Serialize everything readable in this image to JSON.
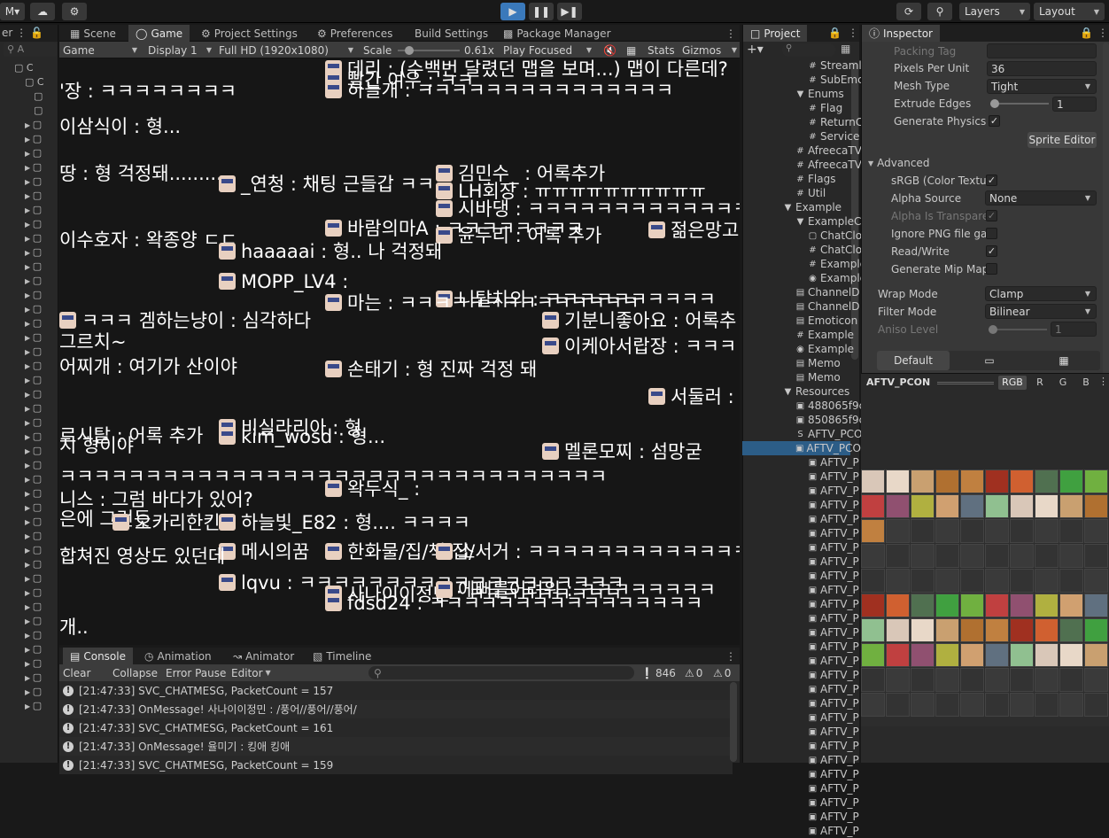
{
  "topbar": {
    "account_label": "M",
    "layers_label": "Layers",
    "layout_label": "Layout"
  },
  "game_tabs": [
    {
      "label": "Scene"
    },
    {
      "label": "Game"
    },
    {
      "label": "Project Settings"
    },
    {
      "label": "Preferences"
    },
    {
      "label": "Build Settings"
    },
    {
      "label": "Package Manager"
    }
  ],
  "game_toolbar": {
    "mode": "Game",
    "display": "Display 1",
    "resolution": "Full HD (1920x1080)",
    "scale_label": "Scale",
    "scale_value": "0.61x",
    "play_focused": "Play Focused",
    "stats": "Stats",
    "gizmos": "Gizmos"
  },
  "hierarchy": {
    "search_placeholder": "A",
    "root_items": [
      "C",
      "C"
    ]
  },
  "chat_lines": [
    {
      "text": "데리 : (수백번 달렸던 맵을 보며...) 맵이 다른데?",
      "avatar": true
    },
    {
      "text": "빨간 여우 : ㅋㅋ",
      "avatar": true
    },
    {
      "text": "하늘개 : ㅋㅋㅋㅋㅋㅋㅋㅋㅋㅋㅋㅋㅋㅋㅋ",
      "avatar": true
    },
    {
      "text": "'장 : ㅋㅋㅋㅋㅋㅋㅋㅋ",
      "avatar": false
    },
    {
      "text": "이삼식이 : 형...",
      "avatar": false
    },
    {
      "text": "땅 : 형 걱정돼.........",
      "avatar": false
    },
    {
      "text": "_연청 : 채팅 근들갑 ㅋㅋ",
      "avatar": true
    },
    {
      "text": "김민수_ : 어록추가",
      "avatar": true
    },
    {
      "text": "LH회장 : ㅠㅠㅠㅠㅠㅠㅠㅠㅠㅠ",
      "avatar": true
    },
    {
      "text": "시바댕 : ㅋㅋㅋㅋㅋㅋㅋㅋㅋㅋㅋㅋㅋㅋ",
      "avatar": true
    },
    {
      "text": "바람의마A : ㅋㅋㅋㅋㅋㅋㅋㅋ",
      "avatar": true
    },
    {
      "text": "윤두리 : 어록 추가",
      "avatar": true
    },
    {
      "text": "젊은망고",
      "avatar": true
    },
    {
      "text": "이수호자 : 왁종양 ㄷㄷ",
      "avatar": false
    },
    {
      "text": "haaaaai : 형.. 나 걱정돼",
      "avatar": true
    },
    {
      "text": "MOPP_LV4 :",
      "avatar": true
    },
    {
      "text": "니탈차의 : ㅋㅋㅋㅋㅋㅋㅋㅋㅋㅋ",
      "avatar": true
    },
    {
      "text": "마는 : ㅋㅋㅋㅋㅋㅋㅋㅋㅋㅋㅋㅋㅋㅋ",
      "avatar": true
    },
    {
      "text": "ㅋㅋㅋ 겜하는냥이 : 심각하다",
      "avatar": true
    },
    {
      "text": "기분니좋아요 : 어록추",
      "avatar": true
    },
    {
      "text": "그르치~",
      "avatar": false
    },
    {
      "text": "이케아서랍장 : ㅋㅋㅋ",
      "avatar": true
    },
    {
      "text": "어찌개 : 여기가 산이야",
      "avatar": false
    },
    {
      "text": "손태기 : 형 진짜 걱정 돼",
      "avatar": true
    },
    {
      "text": "서둘러 :",
      "avatar": true
    },
    {
      "text": "비실라리아 : 형",
      "avatar": true
    },
    {
      "text": "르시탈 : 어록 추가",
      "avatar": false
    },
    {
      "text": "kim_wosd : 형...",
      "avatar": true
    },
    {
      "text": "지 형이야",
      "avatar": false
    },
    {
      "text": "멜론모찌 : 섬망굳",
      "avatar": true
    },
    {
      "text": "ㅋㅋㅋㅋㅋㅋㅋㅋㅋㅋㅋㅋㅋㅋㅋㅋㅋㅋㅋㅋㅋㅋㅋㅋㅋㅋㅋㅋㅋㅋㅋㅋ",
      "avatar": false
    },
    {
      "text": "왁두식_ :",
      "avatar": true
    },
    {
      "text": "니스 : 그럼 바다가 있어?",
      "avatar": false
    },
    {
      "text": "은에 그런듯",
      "avatar": false
    },
    {
      "text": "오카리한킨",
      "avatar": true
    },
    {
      "text": "하늘빛_E82 : 형.... ㅋㅋㅋㅋ",
      "avatar": true
    },
    {
      "text": "메시의꿈",
      "avatar": true
    },
    {
      "text": "한화물/집/책/집/",
      "avatar": true
    },
    {
      "text": "소서거 : ㅋㅋㅋㅋㅋㅋㅋㅋㅋㅋㅋㅋㅋㅋ",
      "avatar": true
    },
    {
      "text": "합쳐진 영상도 있던데",
      "avatar": false
    },
    {
      "text": "lqvu : ㅋㅋㅋㅋㅋㅋㅋㅋㅋㅋㅋㅋㅋㅋㅋㅋㅋㅋㅋ",
      "avatar": true
    },
    {
      "text": "사나이이정민 : ㅋㅋㅋㅋㅋㅋㅋㅋㅋ",
      "avatar": true
    },
    {
      "text": "fdsd24 : ㅋㅋㅋㅋㅋㅋㅋㅋㅋㅋㅋㅋㅋㅋㅋㅋ",
      "avatar": true
    },
    {
      "text": "에뻐를어려워 : ㅋㅋㅋㅋㅋㅋㅋㅋ",
      "avatar": true
    },
    {
      "text": "개..",
      "avatar": false
    }
  ],
  "console": {
    "tabs": [
      "Console",
      "Animation",
      "Animator",
      "Timeline"
    ],
    "clear": "Clear",
    "collapse": "Collapse",
    "error_pause": "Error Pause",
    "editor": "Editor",
    "count_info": "846",
    "count_warn": "0",
    "count_error": "0",
    "logs": [
      "[21:47:33] SVC_CHATMESG, PacketCount = 157",
      "[21:47:33] OnMessage! 사나이이정민 : /풍어//풍어//풍어/",
      "[21:47:33] SVC_CHATMESG, PacketCount = 161",
      "[21:47:33] OnMessage! 율미기 : 킹애 킹애",
      "[21:47:33] SVC_CHATMESG, PacketCount = 159"
    ]
  },
  "project": {
    "tab": "Project",
    "items": [
      {
        "label": "Streaml",
        "icon": "#",
        "indent": 3
      },
      {
        "label": "SubEmc",
        "icon": "#",
        "indent": 3
      },
      {
        "label": "Enums",
        "icon": "folder",
        "indent": 2
      },
      {
        "label": "Flag",
        "icon": "#",
        "indent": 3
      },
      {
        "label": "ReturnC",
        "icon": "#",
        "indent": 3
      },
      {
        "label": "Service",
        "icon": "#",
        "indent": 3
      },
      {
        "label": "AfreecaTV",
        "icon": "#",
        "indent": 2
      },
      {
        "label": "AfreecaTV",
        "icon": "#",
        "indent": 2
      },
      {
        "label": "Flags",
        "icon": "#",
        "indent": 2
      },
      {
        "label": "Util",
        "icon": "#",
        "indent": 2
      },
      {
        "label": "Example",
        "icon": "folder",
        "indent": 1
      },
      {
        "label": "ExampleC",
        "icon": "folder",
        "indent": 2
      },
      {
        "label": "ChatClo",
        "icon": "cube",
        "indent": 3
      },
      {
        "label": "ChatClo",
        "icon": "#",
        "indent": 3
      },
      {
        "label": "Example",
        "icon": "#",
        "indent": 3
      },
      {
        "label": "Example",
        "icon": "unity",
        "indent": 3
      },
      {
        "label": "ChannelD",
        "icon": "doc",
        "indent": 2
      },
      {
        "label": "ChannelD",
        "icon": "doc",
        "indent": 2
      },
      {
        "label": "Emoticon",
        "icon": "doc",
        "indent": 2
      },
      {
        "label": "Example",
        "icon": "#",
        "indent": 2
      },
      {
        "label": "Example",
        "icon": "unity",
        "indent": 2
      },
      {
        "label": "Memo",
        "icon": "doc",
        "indent": 2
      },
      {
        "label": "Memo",
        "icon": "doc",
        "indent": 2
      },
      {
        "label": "Resources",
        "icon": "folder",
        "indent": 1
      },
      {
        "label": "488065f9c",
        "icon": "img",
        "indent": 2
      },
      {
        "label": "850865f9c",
        "icon": "img",
        "indent": 2
      },
      {
        "label": "AFTV_PCO",
        "icon": "S",
        "indent": 2
      },
      {
        "label": "AFTV_PCO",
        "icon": "img",
        "indent": 2
      },
      {
        "label": "AFTV_P",
        "icon": "img",
        "indent": 3
      },
      {
        "label": "AFTV_P",
        "icon": "img",
        "indent": 3
      },
      {
        "label": "AFTV_P",
        "icon": "img",
        "indent": 3
      },
      {
        "label": "AFTV_P",
        "icon": "img",
        "indent": 3
      },
      {
        "label": "AFTV_P",
        "icon": "img",
        "indent": 3
      },
      {
        "label": "AFTV_P",
        "icon": "img",
        "indent": 3
      },
      {
        "label": "AFTV_P",
        "icon": "img",
        "indent": 3
      },
      {
        "label": "AFTV_P",
        "icon": "img",
        "indent": 3
      },
      {
        "label": "AFTV_P",
        "icon": "img",
        "indent": 3
      },
      {
        "label": "AFTV_P",
        "icon": "img",
        "indent": 3
      },
      {
        "label": "AFTV_P",
        "icon": "img",
        "indent": 3
      },
      {
        "label": "AFTV_P",
        "icon": "img",
        "indent": 3
      },
      {
        "label": "AFTV_P",
        "icon": "img",
        "indent": 3
      },
      {
        "label": "AFTV_P",
        "icon": "img",
        "indent": 3
      },
      {
        "label": "AFTV_P",
        "icon": "img",
        "indent": 3
      },
      {
        "label": "AFTV_P",
        "icon": "img",
        "indent": 3
      },
      {
        "label": "AFTV_P",
        "icon": "img",
        "indent": 3
      },
      {
        "label": "AFTV_P",
        "icon": "img",
        "indent": 3
      },
      {
        "label": "AFTV_P",
        "icon": "img",
        "indent": 3
      },
      {
        "label": "AFTV_P",
        "icon": "img",
        "indent": 3
      },
      {
        "label": "AFTV_P",
        "icon": "img",
        "indent": 3
      },
      {
        "label": "AFTV_P",
        "icon": "img",
        "indent": 3
      },
      {
        "label": "AFTV_P",
        "icon": "img",
        "indent": 3
      },
      {
        "label": "AFTV_P",
        "icon": "img",
        "indent": 3
      },
      {
        "label": "AFTV_P",
        "icon": "img",
        "indent": 3
      },
      {
        "label": "AFTV_P",
        "icon": "img",
        "indent": 3
      },
      {
        "label": "AFTV_P",
        "icon": "img",
        "indent": 3
      }
    ]
  },
  "inspector": {
    "tab": "Inspector",
    "packing_tag": "Packing Tag",
    "pixels_per_unit_label": "Pixels Per Unit",
    "pixels_per_unit": "36",
    "mesh_type_label": "Mesh Type",
    "mesh_type": "Tight",
    "extrude_label": "Extrude Edges",
    "extrude": "1",
    "physics_label": "Generate Physics S",
    "sprite_editor": "Sprite Editor",
    "advanced": "Advanced",
    "srgb_label": "sRGB (Color Textu",
    "alpha_source_label": "Alpha Source",
    "alpha_source": "None",
    "alpha_transparency_label": "Alpha Is Transpare",
    "ignore_png_label": "Ignore PNG file gar",
    "read_write_label": "Read/Write",
    "mipmap_label": "Generate Mip Map",
    "wrap_mode_label": "Wrap Mode",
    "wrap_mode": "Clamp",
    "filter_mode_label": "Filter Mode",
    "filter_mode": "Bilinear",
    "aniso_label": "Aniso Level",
    "aniso": "1",
    "platform_default": "Default",
    "preview_name": "AFTV_PCON",
    "channels": [
      "RGB",
      "R",
      "G",
      "B"
    ]
  }
}
